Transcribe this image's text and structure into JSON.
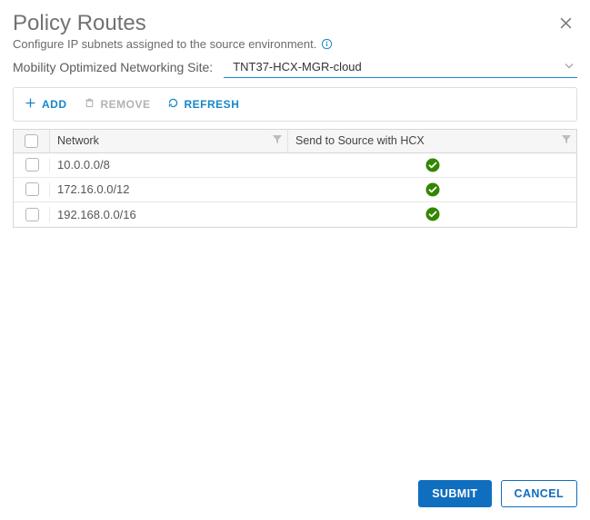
{
  "header": {
    "title": "Policy Routes",
    "subtitle": "Configure IP subnets assigned to the source environment."
  },
  "site": {
    "label": "Mobility Optimized Networking Site:",
    "value": "TNT37-HCX-MGR-cloud"
  },
  "toolbar": {
    "add_label": "ADD",
    "remove_label": "REMOVE",
    "refresh_label": "REFRESH"
  },
  "table": {
    "columns": {
      "network": "Network",
      "hcx": "Send to Source with HCX"
    },
    "rows": [
      {
        "network": "10.0.0.0/8",
        "hcx": true
      },
      {
        "network": "172.16.0.0/12",
        "hcx": true
      },
      {
        "network": "192.168.0.0/16",
        "hcx": true
      }
    ]
  },
  "footer": {
    "submit_label": "SUBMIT",
    "cancel_label": "CANCEL"
  },
  "colors": {
    "primary": "#0f6ebe",
    "link": "#1787c9",
    "success": "#318700"
  }
}
